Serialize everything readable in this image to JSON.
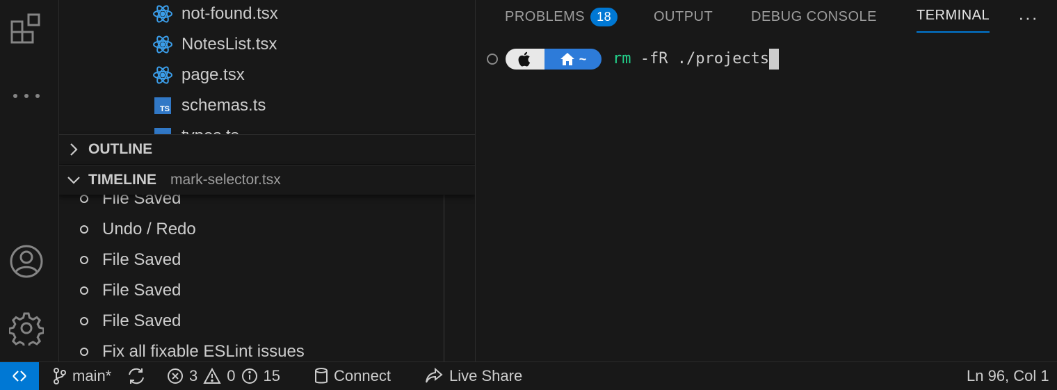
{
  "explorer": {
    "files": [
      {
        "name": "not-found.tsx",
        "icon": "react-icon"
      },
      {
        "name": "NotesList.tsx",
        "icon": "react-icon"
      },
      {
        "name": "page.tsx",
        "icon": "react-icon"
      },
      {
        "name": "schemas.ts",
        "icon": "typescript-icon"
      },
      {
        "name": "types.ts",
        "icon": "typescript-icon"
      }
    ],
    "ts_badge": "TS"
  },
  "outline": {
    "title": "OUTLINE"
  },
  "timeline": {
    "title": "TIMELINE",
    "file": "mark-selector.tsx",
    "items": [
      "File Saved",
      "Undo / Redo",
      "File Saved",
      "File Saved",
      "File Saved",
      "Fix all fixable ESLint issues"
    ]
  },
  "panel": {
    "tabs": {
      "problems": "PROBLEMS",
      "problems_count": "18",
      "output": "OUTPUT",
      "debug": "DEBUG CONSOLE",
      "terminal": "TERMINAL"
    },
    "more": "···"
  },
  "terminal": {
    "home_label": "~",
    "command": "rm",
    "args": " -fR ./projects"
  },
  "statusbar": {
    "branch": "main*",
    "errors": "3",
    "warnings": "0",
    "infos": "15",
    "connect": "Connect",
    "live_share": "Live Share",
    "position": "Ln 96, Col 1"
  },
  "colors": {
    "accent": "#0078d4",
    "react": "#3b9eea",
    "typescript": "#3178c6",
    "terminal_command": "#23d18b",
    "background": "#181818"
  }
}
